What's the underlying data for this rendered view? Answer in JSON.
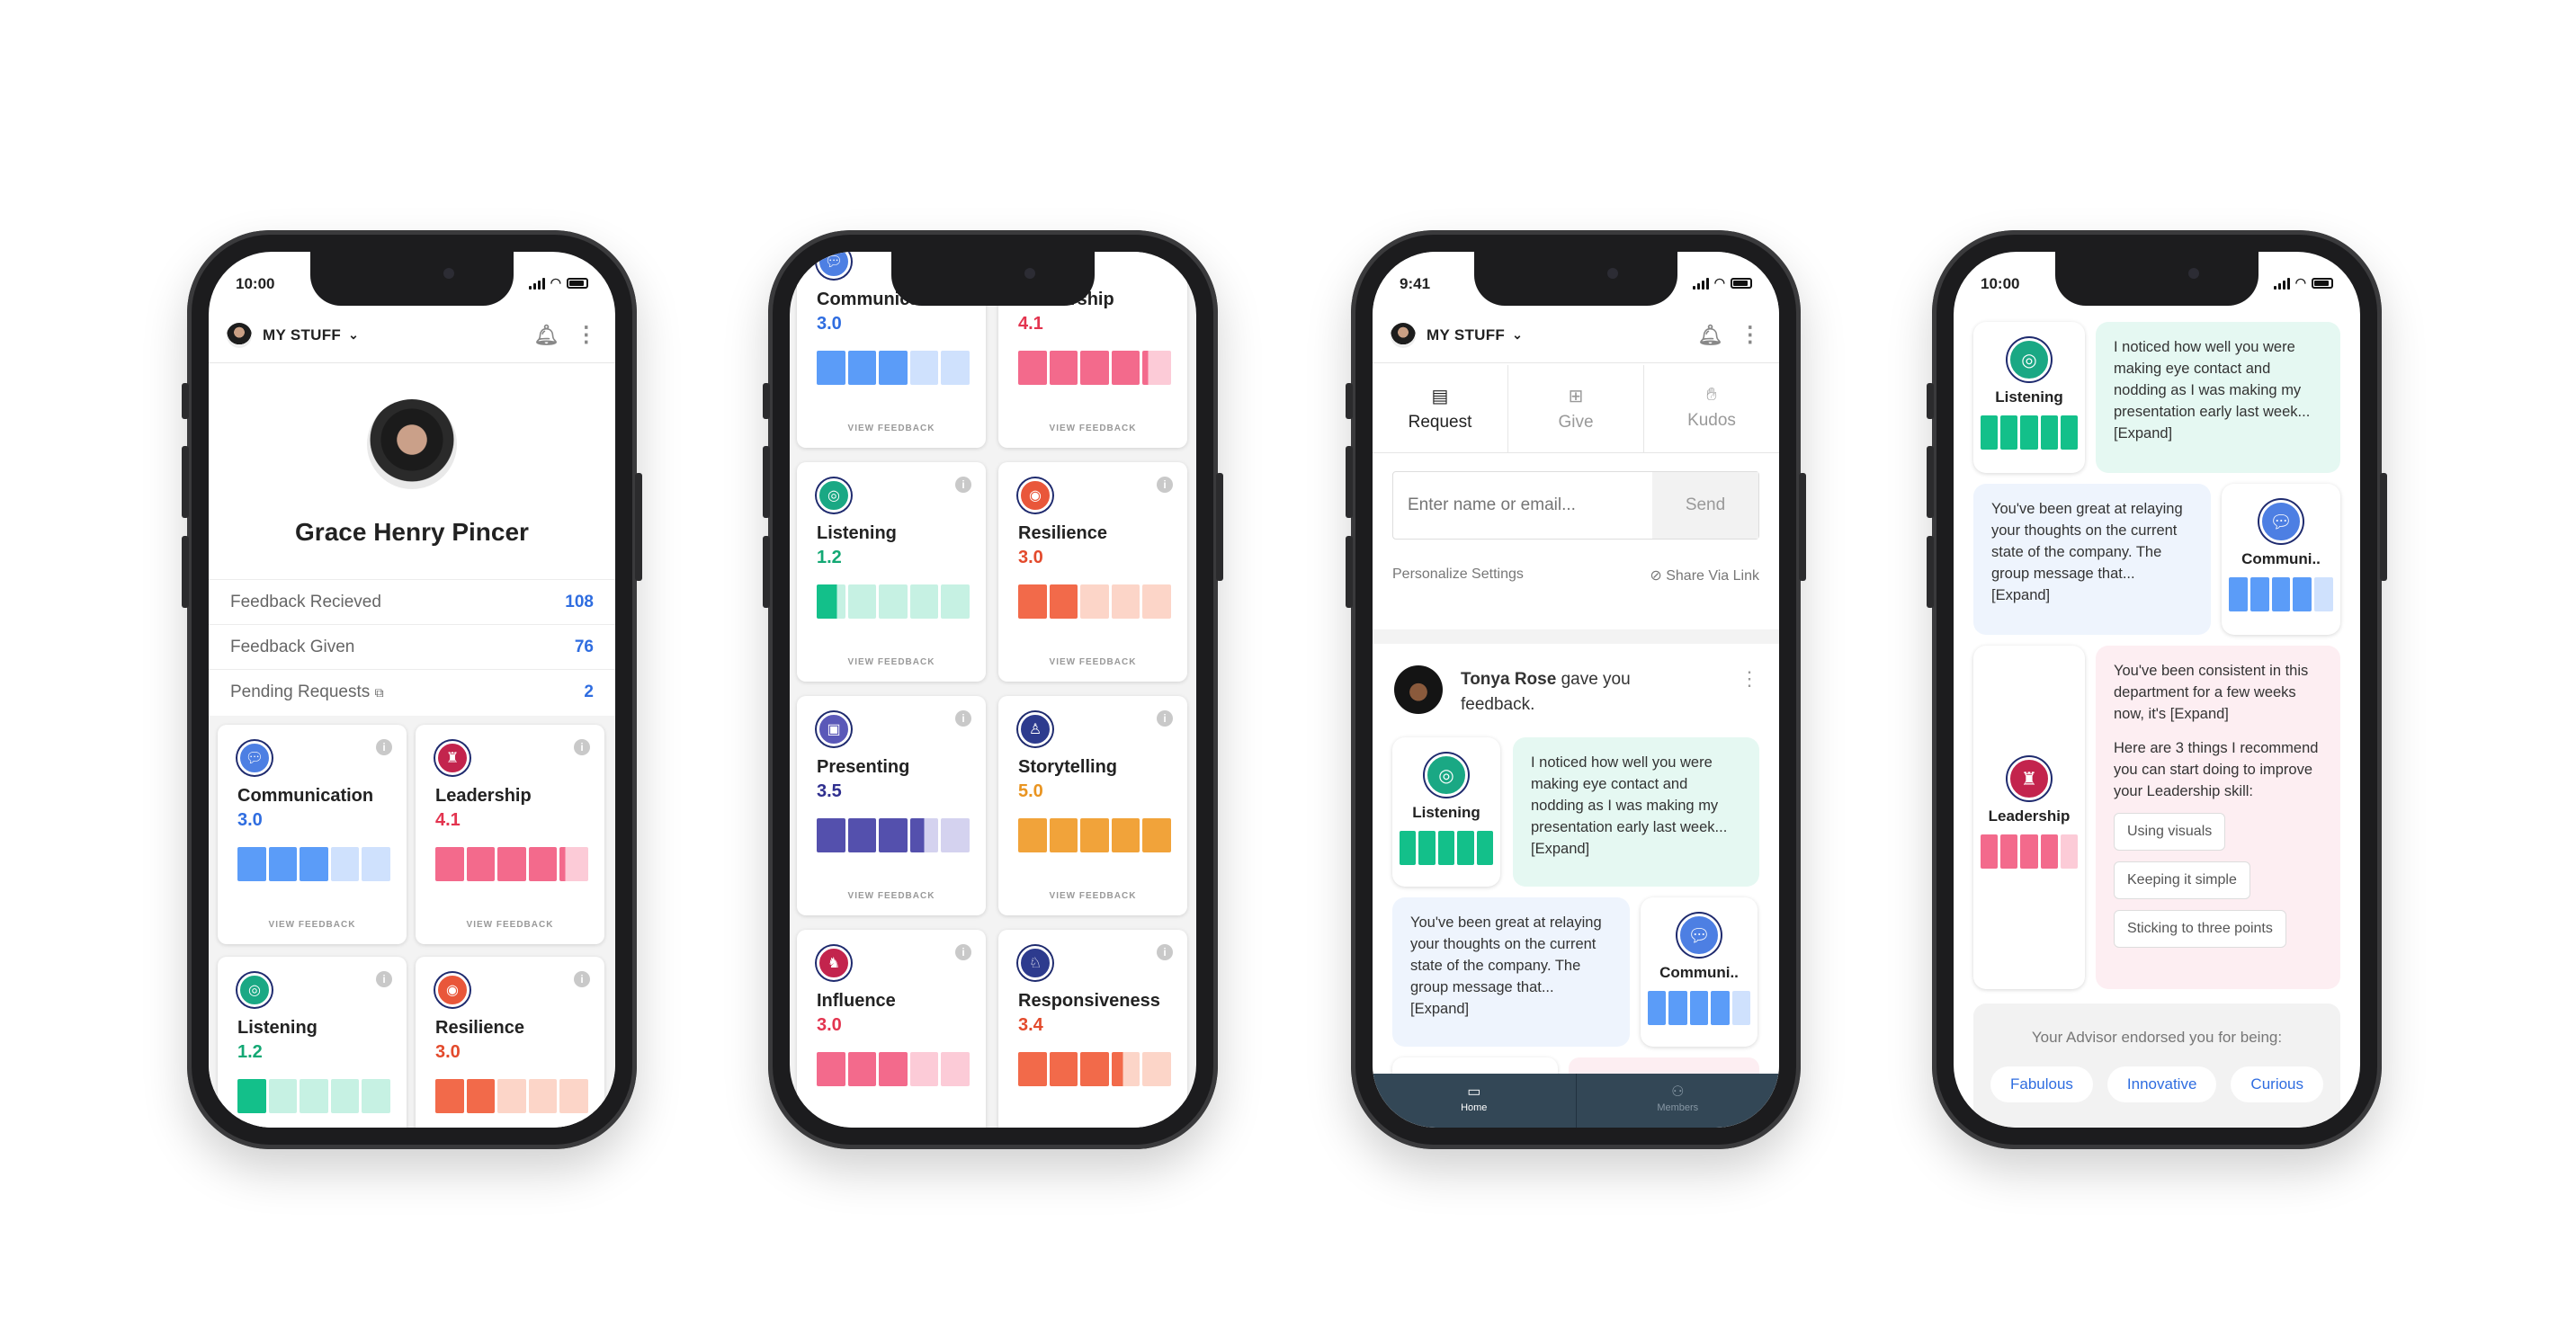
{
  "colors": {
    "accent": "#2f6de0",
    "blue": "#5b9cf8",
    "pink": "#f36a8c",
    "green": "#13c08a",
    "red": "#f26a4a",
    "indigo": "#5450ad",
    "orange": "#f1a33a"
  },
  "phone1": {
    "time": "10:00",
    "menu_title": "MY STUFF",
    "profile_name": "Grace Henry Pincer",
    "stats": [
      {
        "label": "Feedback Recieved",
        "value": "108"
      },
      {
        "label": "Feedback Given",
        "value": "76"
      },
      {
        "label": "Pending Requests",
        "value": "2"
      }
    ],
    "cards": [
      {
        "name": "Communication",
        "score": "3.0",
        "icon": "chat-bubbles-icon"
      },
      {
        "name": "Leadership",
        "score": "4.1",
        "icon": "leader-figure-icon"
      },
      {
        "name": "Listening",
        "score": "1.2",
        "icon": "ear-icon"
      },
      {
        "name": "Resilience",
        "score": "3.0",
        "icon": "target-icon"
      }
    ],
    "view_feedback": "VIEW FEEDBACK"
  },
  "phone2": {
    "cards": [
      {
        "name": "Communication",
        "score": "3.0"
      },
      {
        "name": "Leadership",
        "score": "4.1"
      },
      {
        "name": "Listening",
        "score": "1.2"
      },
      {
        "name": "Resilience",
        "score": "3.0"
      },
      {
        "name": "Presenting",
        "score": "3.5"
      },
      {
        "name": "Storytelling",
        "score": "5.0"
      },
      {
        "name": "Influence",
        "score": "3.0"
      },
      {
        "name": "Responsiveness",
        "score": "3.4"
      }
    ],
    "view_feedback": "VIEW FEEDBACK"
  },
  "phone3": {
    "time": "9:41",
    "menu_title": "MY STUFF",
    "tabs": [
      {
        "label": "Request",
        "icon": "request-icon"
      },
      {
        "label": "Give",
        "icon": "give-icon"
      },
      {
        "label": "Kudos",
        "icon": "kudos-icon"
      }
    ],
    "input_placeholder": "Enter name or email...",
    "send_label": "Send",
    "personalize_label": "Personalize Settings",
    "share_label": "Share Via Link",
    "feed_author": "Tonya Rose",
    "feed_action": "gave you feedback.",
    "listening_label": "Listening",
    "listening_text": "I noticed how well you were making eye contact and nodding as I was making my presentation early last week... ",
    "expand_label": "[Expand]",
    "communication_text": "You've been great at relaying your thoughts on the current state of the company. The group message that... ",
    "communication_label": "Communi..",
    "nav": [
      {
        "label": "Home",
        "icon": "home-chat-icon"
      },
      {
        "label": "Members",
        "icon": "members-icon"
      }
    ]
  },
  "phone4": {
    "time": "10:00",
    "listening_label": "Listening",
    "listening_text": "I noticed how well you were making eye contact and nodding as I was making my presentation early last week... ",
    "communication_text": "You've been great at relaying your thoughts on the current state of the company. The group message that... ",
    "communication_label": "Communi..",
    "expand_label": "[Expand]",
    "leadership_label": "Leadership",
    "leadership_text1": "You've been consistent in this department for a few weeks now, it's ",
    "leadership_text2": "Here are 3 things I recommend you can start doing to improve your Leadership skill:",
    "chips": [
      "Using visuals",
      "Keeping it simple",
      "Sticking to three points"
    ],
    "endorse_text": "Your Advisor endorsed you for being:",
    "endorsements": [
      "Fabulous",
      "Innovative",
      "Curious"
    ]
  }
}
